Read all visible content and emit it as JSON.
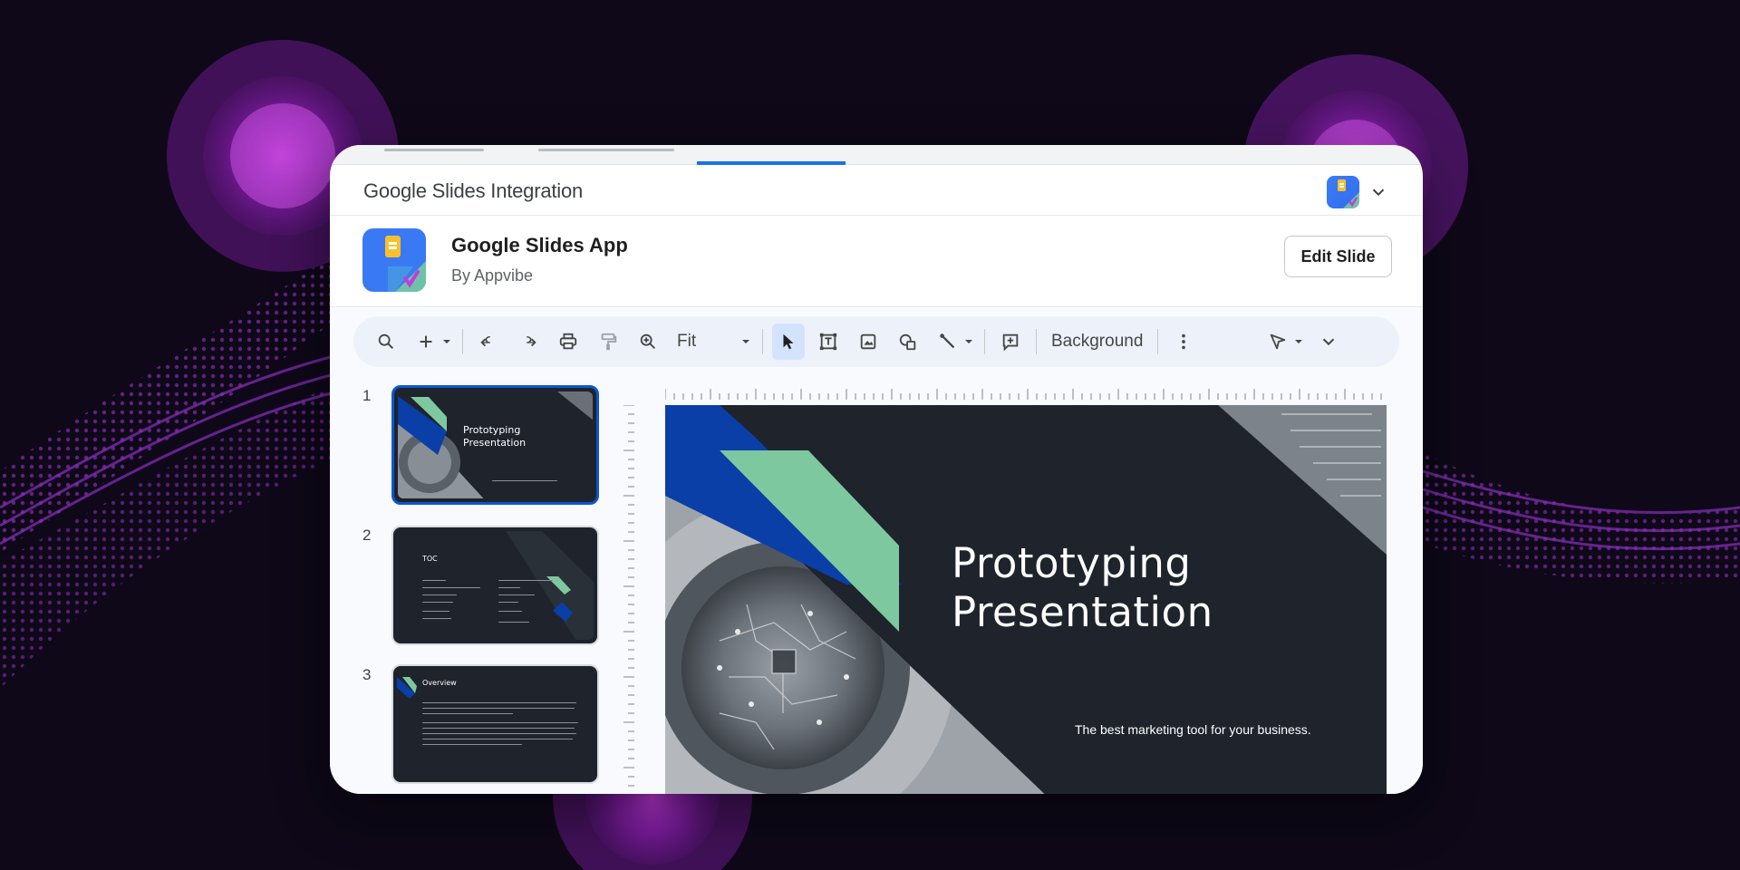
{
  "panel": {
    "title": "Google Slides Integration"
  },
  "app": {
    "name": "Google Slides App",
    "by": "By Appvibe",
    "edit_label": "Edit Slide"
  },
  "toolbar": {
    "zoom_value": "Fit",
    "background_label": "Background",
    "icons": [
      "search-icon",
      "add-icon",
      "undo-icon",
      "redo-icon",
      "print-icon",
      "paint-format-icon",
      "zoom-icon",
      "select-icon",
      "text-box-icon",
      "image-icon",
      "shape-icon",
      "line-icon",
      "comment-icon",
      "more-icon",
      "pen-icon",
      "chevron-down-icon"
    ]
  },
  "slides": [
    {
      "number": "1",
      "title_line1": "Prototyping",
      "title_line2": "Presentation"
    },
    {
      "number": "2",
      "title": "TOC"
    },
    {
      "number": "3",
      "title": "Overview"
    }
  ],
  "current_slide": {
    "title_line1": "Prototyping",
    "title_line2": "Presentation",
    "subtitle": "The best marketing tool for your business."
  },
  "colors": {
    "accent_blue": "#0b57d0",
    "slide_bg": "#1e232c",
    "slide_green": "#7ec8a0",
    "slide_blue": "#0a3fa8",
    "page_bg": "#0e0818",
    "purple_glow": "#a020c0"
  }
}
